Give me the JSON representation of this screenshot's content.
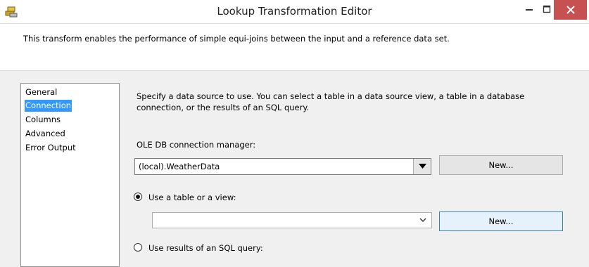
{
  "window": {
    "title": "Lookup Transformation Editor"
  },
  "header": {
    "description": "This transform enables the performance of simple equi-joins between the input and a reference data set."
  },
  "nav": {
    "items": [
      {
        "label": "General"
      },
      {
        "label": "Connection",
        "selected": true
      },
      {
        "label": "Columns"
      },
      {
        "label": "Advanced"
      },
      {
        "label": "Error Output"
      }
    ]
  },
  "connection": {
    "description": "Specify a data source to use. You can select a table in a data source view, a table in a database connection, or the results of an SQL query.",
    "manager_label": "OLE DB connection manager:",
    "manager_value": "(local).WeatherData",
    "new_label": "New...",
    "use_table_label": "Use a table or a view:",
    "table_value": "",
    "table_new_label": "New...",
    "use_sql_label": "Use results of an SQL query:",
    "use_table_selected": true
  },
  "colors": {
    "selection": "#3399ff",
    "close_button": "#c75050",
    "hot_button": "#e5f1fb"
  }
}
